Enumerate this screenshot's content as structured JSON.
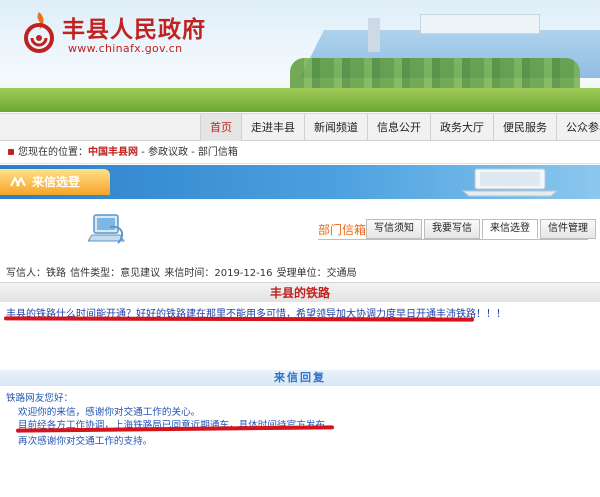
{
  "header": {
    "site_title": "丰县人民政府",
    "site_url": "www.chinafx.gov.cn"
  },
  "nav": {
    "items": [
      "首页",
      "走进丰县",
      "新闻频道",
      "信息公开",
      "政务大厅",
      "便民服务",
      "公众参与"
    ],
    "active_index": 0
  },
  "breadcrumb": {
    "prefix": "您现在的位置：",
    "home": "中国丰县网",
    "path": " - 参政议政 - 部门信箱"
  },
  "section": {
    "title": "来信选登"
  },
  "mailbox": {
    "label": "部门信箱",
    "tabs": [
      "写信须知",
      "我要写信",
      "来信选登",
      "信件管理"
    ],
    "active_tab_index": 2
  },
  "letter": {
    "meta": "写信人：铁路  信件类型：意见建议  来信时间：2019-12-16  受理单位：交通局",
    "title": "丰县的铁路",
    "body": "丰县的铁路什么时间能开通？好好的铁路建在那里不能用多可惜，希望领导加大协调力度早日开通丰沛铁路！！！"
  },
  "reply": {
    "title": "来信回复",
    "lines": [
      "铁路网友您好：",
      "欢迎你的来信，感谢你对交通工作的关心。",
      "目前经各方工作协调，上海铁路局已同意近期通车，具体时间待官方发布。",
      "再次感谢你对交通工作的支持。"
    ]
  },
  "colors": {
    "brand_red": "#c0221f",
    "band_blue": "#2b7fc9",
    "tab_orange": "#f6a428",
    "highlight_red": "#d4131b",
    "text_blue": "#1c3fa6"
  }
}
